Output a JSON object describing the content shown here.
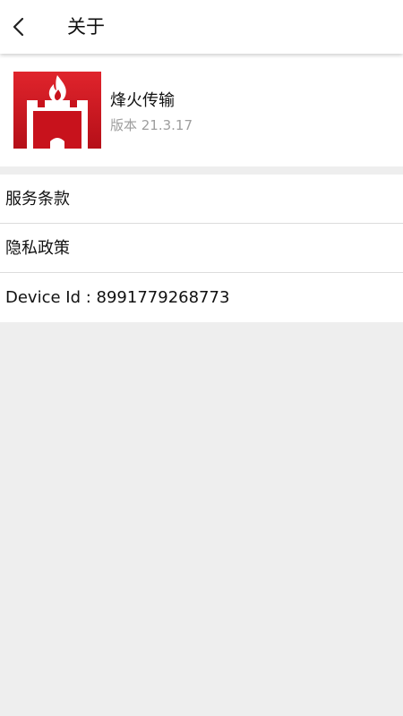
{
  "header": {
    "back_icon": "chevron-left-icon",
    "title": "关于"
  },
  "app": {
    "logo_icon": "fire-tower-logo",
    "name": "烽火传输",
    "version": "版本 21.3.17",
    "brand_color": "#c8121c"
  },
  "menu": {
    "items": [
      {
        "label": "服务条款"
      },
      {
        "label": "隐私政策"
      }
    ],
    "device_id": "Device Id : 8991779268773"
  },
  "colors": {
    "background": "#eeeeee",
    "surface": "#ffffff",
    "secondary_text": "#9e9e9e"
  }
}
